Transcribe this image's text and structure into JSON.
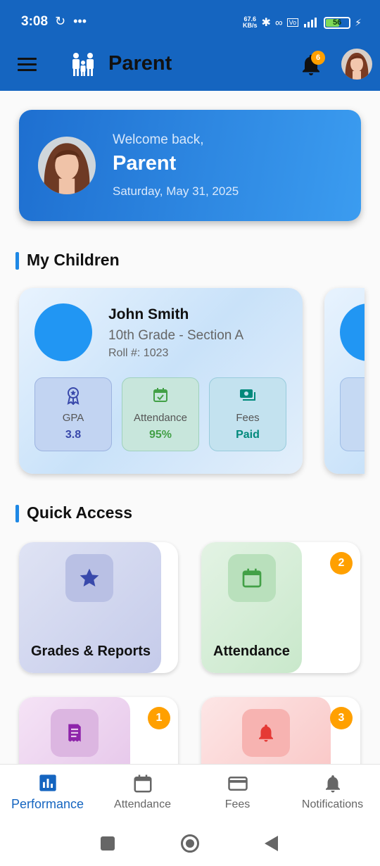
{
  "status_bar": {
    "time": "3:08",
    "speed_top": "67.6",
    "speed_bottom": "KB/s",
    "battery": "56"
  },
  "app_bar": {
    "title": "Parent",
    "notification_count": "6"
  },
  "welcome": {
    "greeting": "Welcome back,",
    "name": "Parent",
    "date": "Saturday, May 31, 2025"
  },
  "sections": {
    "children": "My Children",
    "quick_access": "Quick Access"
  },
  "child": {
    "name": "John Smith",
    "grade": "10th Grade - Section A",
    "roll": "Roll #: 1023",
    "stats": [
      {
        "label": "GPA",
        "value": "3.8",
        "color": "#3949ab"
      },
      {
        "label": "Attendance",
        "value": "95%",
        "color": "#43a047"
      },
      {
        "label": "Fees",
        "value": "Paid",
        "color": "#00897b"
      }
    ]
  },
  "quick_access": [
    {
      "label": "Grades & Reports",
      "badge": ""
    },
    {
      "label": "Attendance",
      "badge": "2"
    },
    {
      "label": "",
      "badge": "1"
    },
    {
      "label": "",
      "badge": "3"
    }
  ],
  "bottom_nav": [
    {
      "label": "Performance",
      "active": true
    },
    {
      "label": "Attendance",
      "active": false
    },
    {
      "label": "Fees",
      "active": false
    },
    {
      "label": "Notifications",
      "active": false
    }
  ],
  "colors": {
    "primary": "#1565c0",
    "accent": "#1e88e5",
    "badge": "#ffa000"
  }
}
